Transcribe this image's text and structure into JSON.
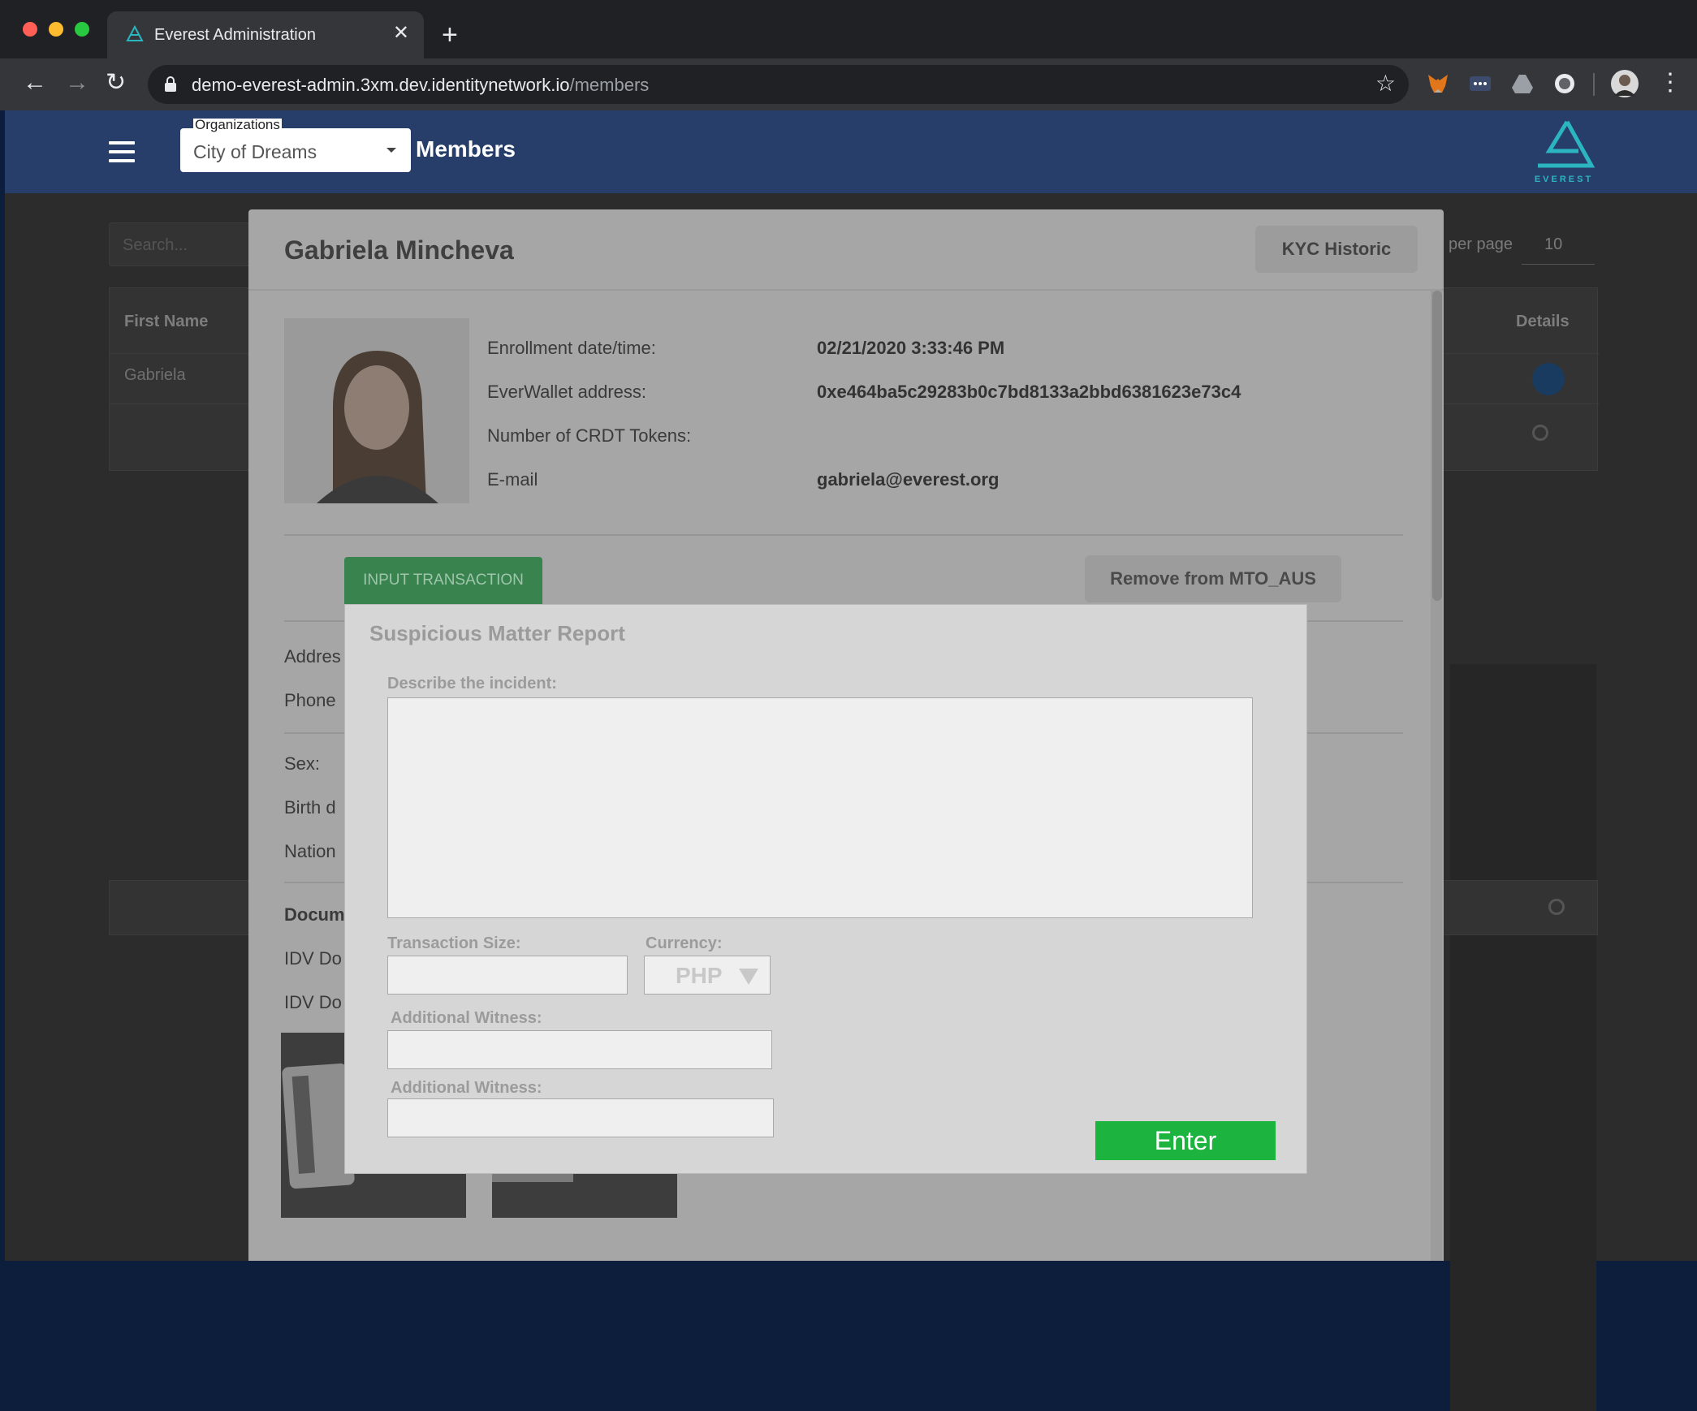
{
  "browser": {
    "tab_title": "Everest Administration",
    "tab_close": "✕",
    "new_tab": "+",
    "url_host": "demo-everest-admin.3xm.dev.identitynetwork.io",
    "url_path": "/members",
    "back": "←",
    "forward": "→",
    "reload": "↻",
    "star": "☆",
    "menu": "⋮"
  },
  "header": {
    "org_label": "Organizations",
    "org_value": "City of Dreams",
    "page_title": "Members",
    "logo_text": "EVEREST"
  },
  "background": {
    "search_placeholder": "Search...",
    "per_page_label": "per page",
    "per_page_value": "10",
    "col_first_name": "First Name",
    "col_details": "Details",
    "row_first_name": "Gabriela"
  },
  "modal": {
    "name": "Gabriela Mincheva",
    "kyc_button": "KYC Historic",
    "fields": [
      {
        "label": "Enrollment date/time:",
        "value": "02/21/2020 3:33:46 PM"
      },
      {
        "label": "EverWallet address:",
        "value": "0xe464ba5c29283b0c7bd8133a2bbd6381623e73c4"
      },
      {
        "label": "Number of CRDT Tokens:",
        "value": ""
      },
      {
        "label": "E-mail",
        "value": "gabriela@everest.org"
      }
    ],
    "input_transaction": "INPUT TRANSACTION",
    "remove_button": "Remove from MTO_AUS",
    "partial_labels": {
      "address": "Addres",
      "phone": "Phone",
      "sex": "Sex:",
      "birth": "Birth d",
      "nationality": "Nation",
      "documents": "Docum",
      "idv1": "IDV Do",
      "idv2": "IDV Do"
    }
  },
  "smr": {
    "title": "Suspicious Matter Report",
    "describe_label": "Describe the incident:",
    "describe_value": "",
    "transaction_size_label": "Transaction Size:",
    "transaction_size_value": "",
    "currency_label": "Currency:",
    "currency_value": "PHP",
    "witness1_label": "Additional Witness:",
    "witness1_value": "",
    "witness2_label": "Additional Witness:",
    "witness2_value": "",
    "enter_button": "Enter"
  },
  "colors": {
    "header_bg": "#273e6a",
    "input_transaction_green": "#39834f",
    "enter_green": "#1db33f",
    "logo_teal": "#2bb5c0"
  }
}
